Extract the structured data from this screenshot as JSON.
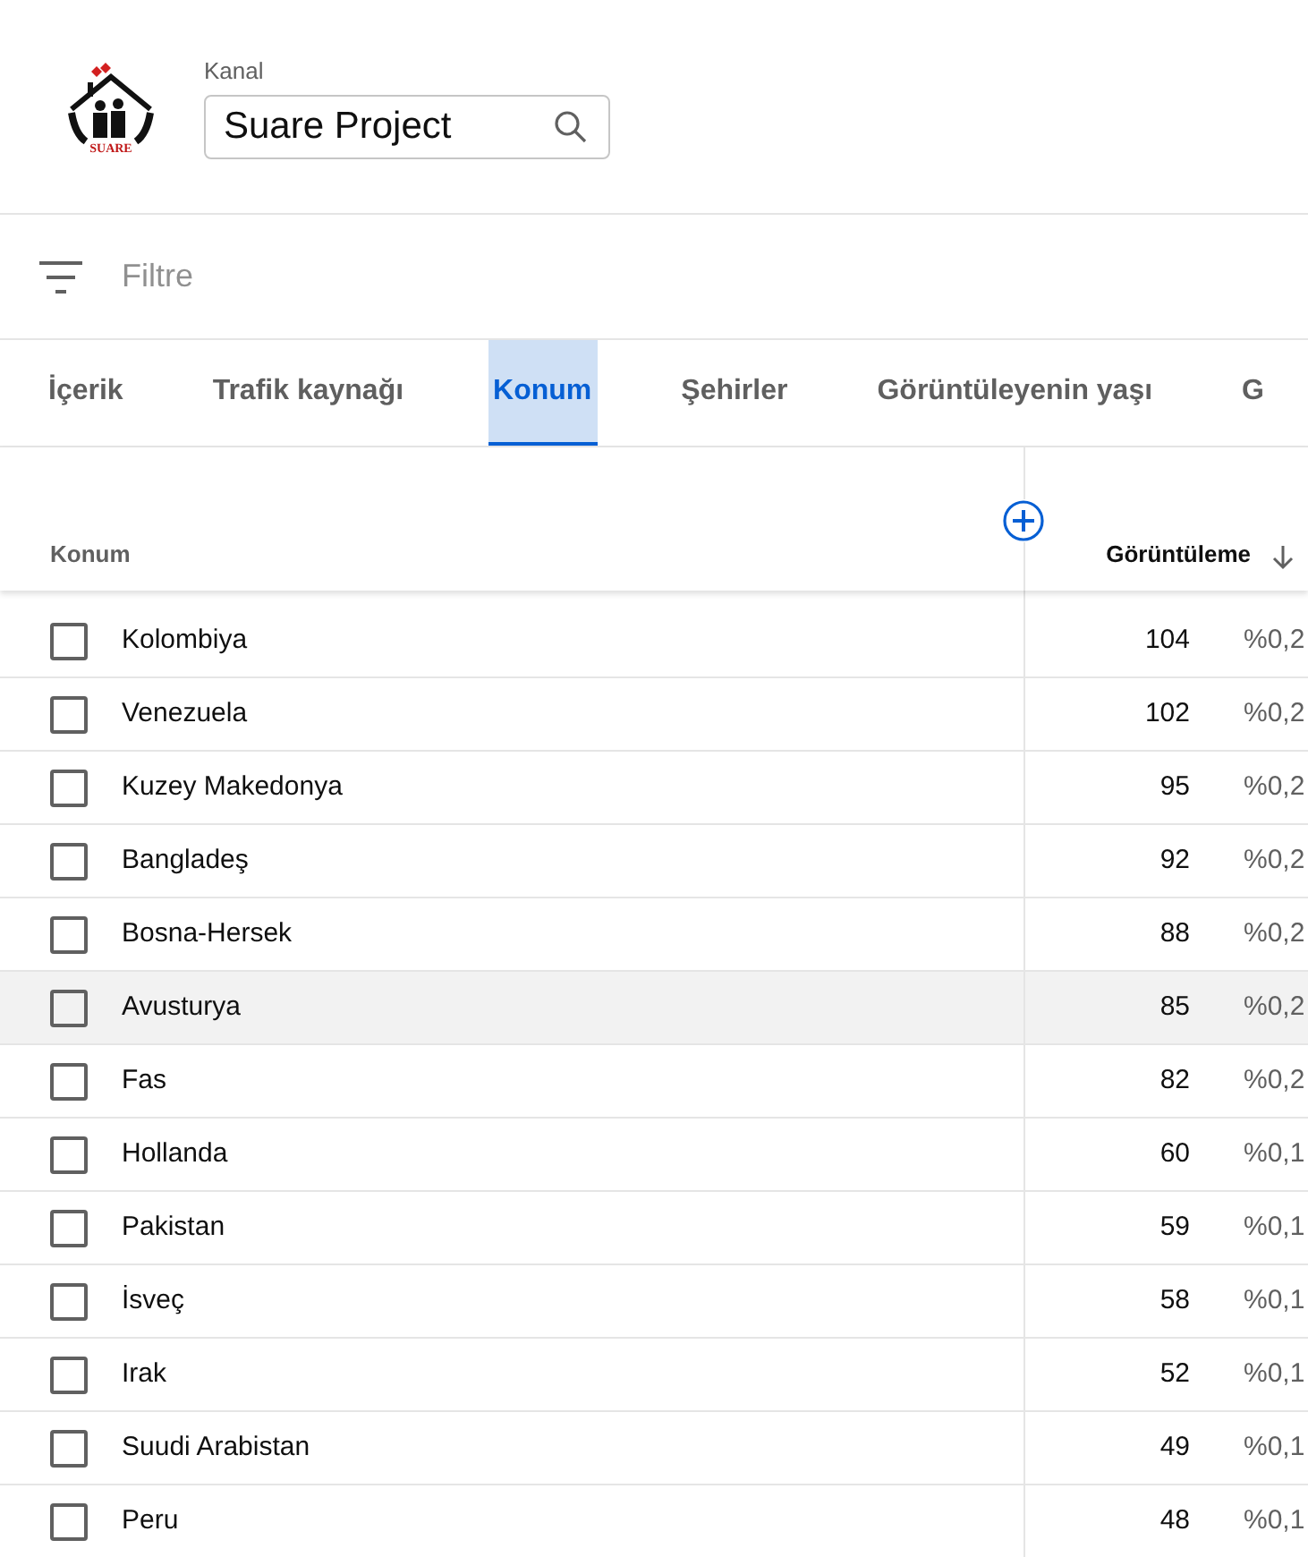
{
  "channel": {
    "label": "Kanal",
    "logo_text": "SUARE",
    "search": {
      "value": "Suare Project"
    }
  },
  "filter": {
    "placeholder": "Filtre"
  },
  "tabs": [
    {
      "label": "İçerik",
      "selected": false
    },
    {
      "label": "Trafik kaynağı",
      "selected": false
    },
    {
      "label": "Konum",
      "selected": true
    },
    {
      "label": "Şehirler",
      "selected": false
    },
    {
      "label": "Görüntüleyenin yaşı",
      "selected": false
    },
    {
      "label": "G",
      "selected": false
    }
  ],
  "table": {
    "columns": [
      {
        "label": "Konum"
      },
      {
        "label": "Görüntüleme",
        "sort_descending": true
      }
    ],
    "rows": [
      {
        "name": "Kolombiya",
        "views": "104",
        "share": "%0,2",
        "checked": false,
        "highlighted": false
      },
      {
        "name": "Venezuela",
        "views": "102",
        "share": "%0,2",
        "checked": false,
        "highlighted": false
      },
      {
        "name": "Kuzey Makedonya",
        "views": "95",
        "share": "%0,2",
        "checked": false,
        "highlighted": false
      },
      {
        "name": "Bangladeş",
        "views": "92",
        "share": "%0,2",
        "checked": false,
        "highlighted": false
      },
      {
        "name": "Bosna-Hersek",
        "views": "88",
        "share": "%0,2",
        "checked": false,
        "highlighted": false
      },
      {
        "name": "Avusturya",
        "views": "85",
        "share": "%0,2",
        "checked": false,
        "highlighted": true
      },
      {
        "name": "Fas",
        "views": "82",
        "share": "%0,2",
        "checked": false,
        "highlighted": false
      },
      {
        "name": "Hollanda",
        "views": "60",
        "share": "%0,1",
        "checked": false,
        "highlighted": false
      },
      {
        "name": "Pakistan",
        "views": "59",
        "share": "%0,1",
        "checked": false,
        "highlighted": false
      },
      {
        "name": "İsveç",
        "views": "58",
        "share": "%0,1",
        "checked": false,
        "highlighted": false
      },
      {
        "name": "Irak",
        "views": "52",
        "share": "%0,1",
        "checked": false,
        "highlighted": false
      },
      {
        "name": "Suudi Arabistan",
        "views": "49",
        "share": "%0,1",
        "checked": false,
        "highlighted": false
      },
      {
        "name": "Peru",
        "views": "48",
        "share": "%0,1",
        "checked": false,
        "highlighted": false
      }
    ]
  }
}
